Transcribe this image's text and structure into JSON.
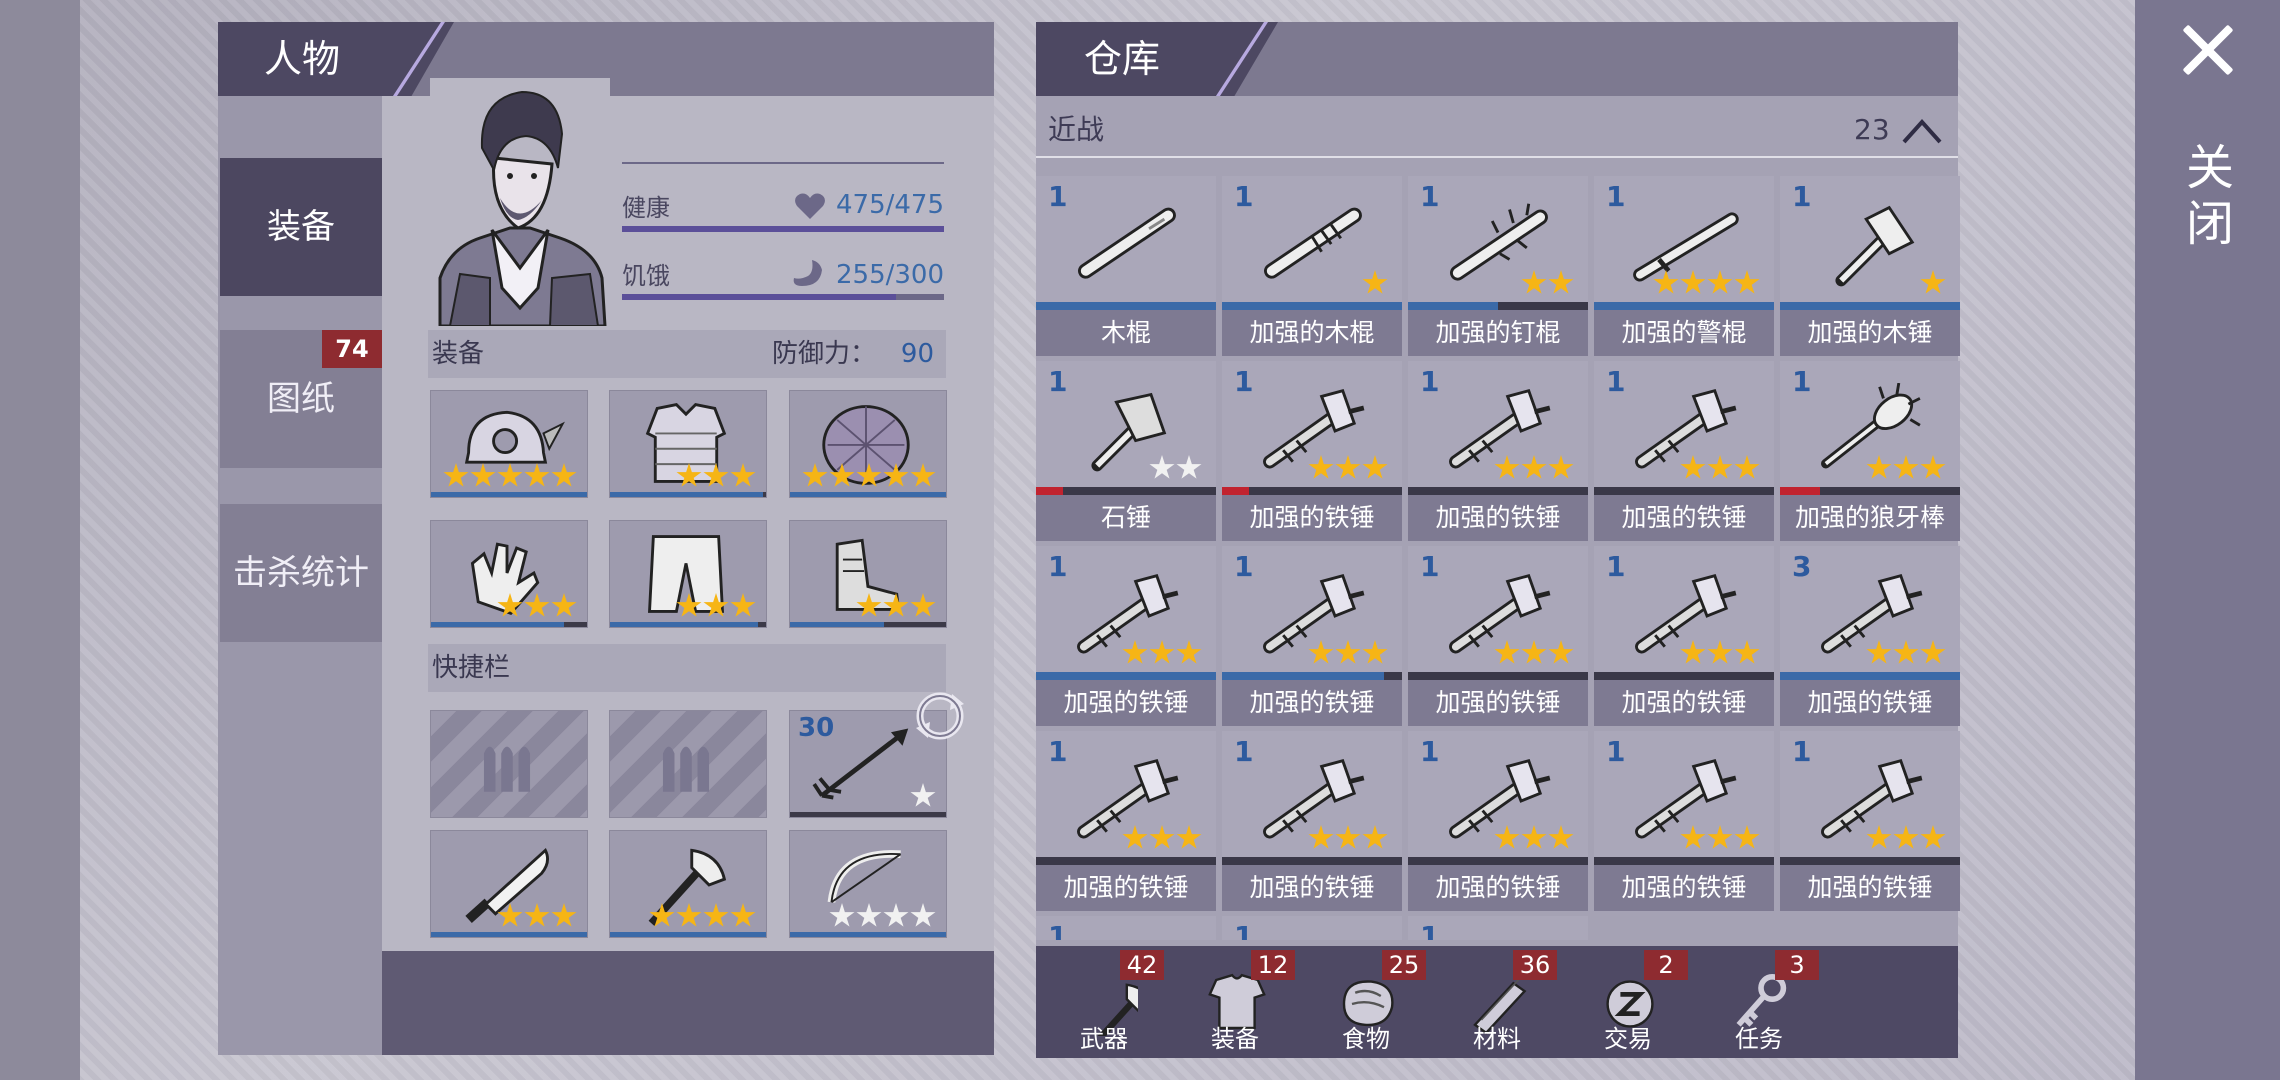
{
  "close": {
    "label": "关闭"
  },
  "character": {
    "title": "人物",
    "tabs": [
      {
        "label": "装备",
        "badge": ""
      },
      {
        "label": "图纸",
        "badge": "74"
      },
      {
        "label": "击杀统计",
        "badge": ""
      }
    ],
    "health_label": "健康",
    "health_value": "475/475",
    "health_fraction": 1.0,
    "hunger_label": "饥饿",
    "hunger_value": "255/300",
    "hunger_fraction": 0.85,
    "equipment_label": "装备",
    "defense_label": "防御力：",
    "defense_value": "90",
    "equipment": [
      {
        "icon": "helmet-icon",
        "stars": 5
      },
      {
        "icon": "armor-vest-icon",
        "stars": 3
      },
      {
        "icon": "turtle-shell-icon",
        "stars": 5
      },
      {
        "icon": "gloves-icon",
        "stars": 3
      },
      {
        "icon": "pants-icon",
        "stars": 3
      },
      {
        "icon": "boots-icon",
        "stars": 3
      }
    ],
    "quickbar_label": "快捷栏",
    "quickbar": [
      {
        "icon": "ammo-slot-icon",
        "empty": true
      },
      {
        "icon": "ammo-slot-icon",
        "empty": true
      },
      {
        "icon": "arrow-icon",
        "count": "30",
        "stars": 1,
        "white": true
      },
      {
        "icon": "machete-icon",
        "stars": 3
      },
      {
        "icon": "axe-icon",
        "stars": 4
      },
      {
        "icon": "bow-icon",
        "stars": 4,
        "white": true
      }
    ]
  },
  "storage": {
    "title": "仓库",
    "category": "近战",
    "category_count": "23",
    "items": [
      {
        "count": "1",
        "name": "木棍",
        "stars": 0,
        "icon": "wooden-stick-icon",
        "dur_color": "#3b6aa8",
        "dur": 1.0
      },
      {
        "count": "1",
        "name": "加强的木棍",
        "stars": 1,
        "icon": "reinforced-stick-icon",
        "dur_color": "#3b6aa8",
        "dur": 1.0
      },
      {
        "count": "1",
        "name": "加强的钉棍",
        "stars": 2,
        "icon": "spiked-club-icon",
        "dur_color": "#3b6aa8",
        "dur": 0.5
      },
      {
        "count": "1",
        "name": "加强的警棍",
        "stars": 4,
        "icon": "baton-icon",
        "dur_color": "#3b6aa8",
        "dur": 1.0
      },
      {
        "count": "1",
        "name": "加强的木锤",
        "stars": 1,
        "icon": "wooden-hammer-icon",
        "dur_color": "#3b6aa8",
        "dur": 1.0
      },
      {
        "count": "1",
        "name": "石锤",
        "stars": 2,
        "white": true,
        "icon": "stone-hammer-icon",
        "dur_color": "#c1232f",
        "dur": 0.15
      },
      {
        "count": "1",
        "name": "加强的铁锤",
        "stars": 3,
        "icon": "iron-hammer-icon",
        "dur_color": "#c1232f",
        "dur": 0.15
      },
      {
        "count": "1",
        "name": "加强的铁锤",
        "stars": 3,
        "icon": "iron-hammer-icon",
        "dur_color": "#3b6aa8",
        "dur": 0.0
      },
      {
        "count": "1",
        "name": "加强的铁锤",
        "stars": 3,
        "icon": "iron-hammer-icon",
        "dur_color": "#3b6aa8",
        "dur": 0.0
      },
      {
        "count": "1",
        "name": "加强的狼牙棒",
        "stars": 3,
        "icon": "wolf-tooth-mace-icon",
        "dur_color": "#c1232f",
        "dur": 0.22
      },
      {
        "count": "1",
        "name": "加强的铁锤",
        "stars": 3,
        "icon": "iron-hammer-icon",
        "dur_color": "#3b6aa8",
        "dur": 1.0
      },
      {
        "count": "1",
        "name": "加强的铁锤",
        "stars": 3,
        "icon": "iron-hammer-icon",
        "dur_color": "#3b6aa8",
        "dur": 0.9
      },
      {
        "count": "1",
        "name": "加强的铁锤",
        "stars": 3,
        "icon": "iron-hammer-icon",
        "dur_color": "#3b6aa8",
        "dur": 0.0
      },
      {
        "count": "1",
        "name": "加强的铁锤",
        "stars": 3,
        "icon": "iron-hammer-icon",
        "dur_color": "#3b6aa8",
        "dur": 0.0
      },
      {
        "count": "3",
        "name": "加强的铁锤",
        "stars": 3,
        "icon": "iron-hammer-icon",
        "dur_color": "#3b6aa8",
        "dur": 1.0
      },
      {
        "count": "1",
        "name": "加强的铁锤",
        "stars": 3,
        "icon": "iron-hammer-icon",
        "dur_color": "#3b6aa8",
        "dur": 0.0
      },
      {
        "count": "1",
        "name": "加强的铁锤",
        "stars": 3,
        "icon": "iron-hammer-icon",
        "dur_color": "#3b6aa8",
        "dur": 0.0
      },
      {
        "count": "1",
        "name": "加强的铁锤",
        "stars": 3,
        "icon": "iron-hammer-icon",
        "dur_color": "#3b6aa8",
        "dur": 0.0
      },
      {
        "count": "1",
        "name": "加强的铁锤",
        "stars": 3,
        "icon": "iron-hammer-icon",
        "dur_color": "#3b6aa8",
        "dur": 0.0
      },
      {
        "count": "1",
        "name": "加强的铁锤",
        "stars": 3,
        "icon": "iron-hammer-icon",
        "dur_color": "#3b6aa8",
        "dur": 0.0
      },
      {
        "count": "1",
        "name": "",
        "stars": 0,
        "icon": "",
        "dur_color": "#3b6aa8",
        "dur": 0.0
      },
      {
        "count": "1",
        "name": "",
        "stars": 0,
        "icon": "",
        "dur_color": "#3b6aa8",
        "dur": 0.0
      },
      {
        "count": "1",
        "name": "",
        "stars": 0,
        "icon": "",
        "dur_color": "#3b6aa8",
        "dur": 0.0
      }
    ],
    "categories": [
      {
        "label": "武器",
        "badge": "42",
        "icon": "axe-icon"
      },
      {
        "label": "装备",
        "badge": "12",
        "icon": "shirt-icon"
      },
      {
        "label": "食物",
        "badge": "25",
        "icon": "meat-icon"
      },
      {
        "label": "材料",
        "badge": "36",
        "icon": "logs-icon"
      },
      {
        "label": "交易",
        "badge": "2",
        "icon": "coin-icon"
      },
      {
        "label": "任务",
        "badge": "3",
        "icon": "key-icon"
      }
    ]
  }
}
